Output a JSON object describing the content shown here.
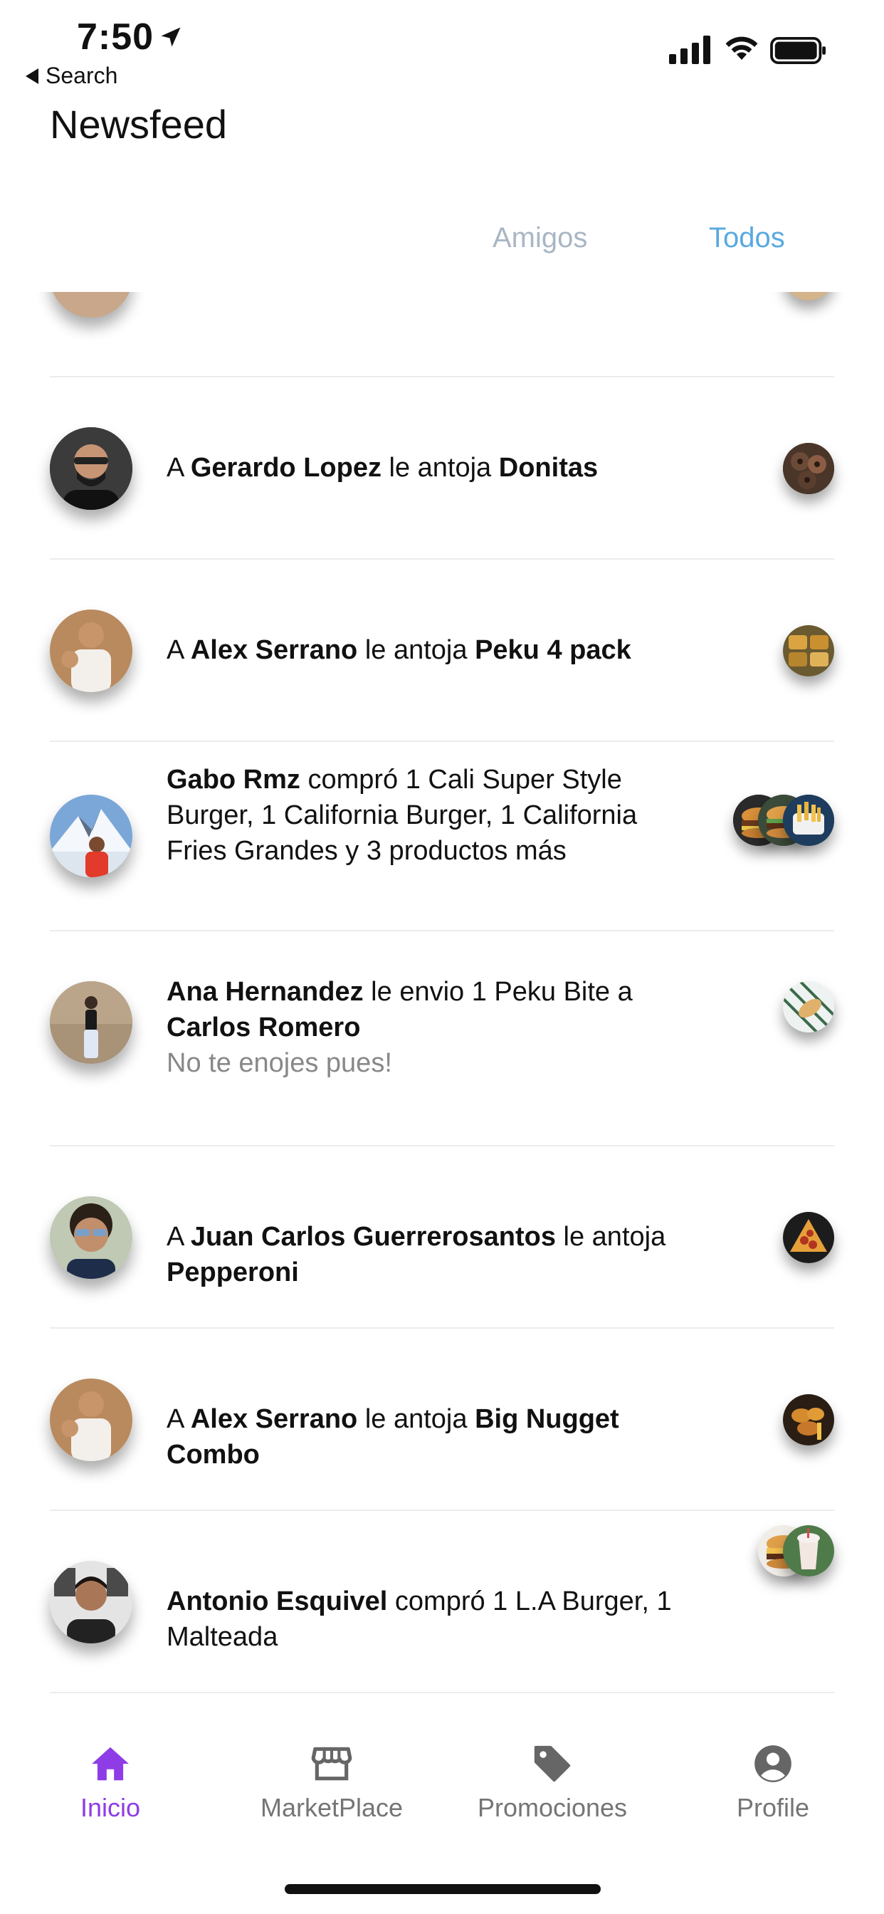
{
  "status_bar": {
    "time": "7:50",
    "back_label": "Search"
  },
  "header": {
    "title": "Newsfeed"
  },
  "tabs": [
    {
      "label": "Amigos",
      "active": false
    },
    {
      "label": "Todos",
      "active": true
    }
  ],
  "feed": [
    {
      "segments": [
        {
          "text": "A ",
          "bold": false
        },
        {
          "text": "Gerardo  Lopez",
          "bold": true
        },
        {
          "text": "  le antoja ",
          "bold": false
        },
        {
          "text": "Donitas",
          "bold": true
        }
      ],
      "thumbs": [
        "donuts"
      ]
    },
    {
      "segments": [
        {
          "text": "A ",
          "bold": false
        },
        {
          "text": "Alex  Serrano",
          "bold": true
        },
        {
          "text": " le antoja ",
          "bold": false
        },
        {
          "text": "Peku 4 pack",
          "bold": true
        }
      ],
      "thumbs": [
        "peku-pack"
      ]
    },
    {
      "segments": [
        {
          "text": "Gabo Rmz",
          "bold": true
        },
        {
          "text": " compró 1 Cali Super Style Burger, 1 California Burger, 1 California Fries Grandes y 3 productos más",
          "bold": false
        }
      ],
      "thumbs": [
        "burger",
        "burger",
        "fries"
      ]
    },
    {
      "segments": [
        {
          "text": "Ana  Hernandez",
          "bold": true
        },
        {
          "text": "  le envio 1 Peku Bite a ",
          "bold": false
        },
        {
          "text": "Carlos Romero",
          "bold": true
        }
      ],
      "subtext": "No te enojes pues!",
      "thumbs": [
        "peku-bite"
      ]
    },
    {
      "segments": [
        {
          "text": "A ",
          "bold": false
        },
        {
          "text": "Juan Carlos Guerrerosantos",
          "bold": true
        },
        {
          "text": " le antoja ",
          "bold": false
        },
        {
          "text": "Pepperoni",
          "bold": true
        }
      ],
      "thumbs": [
        "pepperoni"
      ]
    },
    {
      "segments": [
        {
          "text": "A ",
          "bold": false
        },
        {
          "text": "Alex  Serrano",
          "bold": true
        },
        {
          "text": " le antoja ",
          "bold": false
        },
        {
          "text": "Big Nugget Combo",
          "bold": true
        }
      ],
      "thumbs": [
        "nuggets"
      ]
    },
    {
      "segments": [
        {
          "text": "Antonio Esquivel",
          "bold": true
        },
        {
          "text": " compró 1 L.A Burger, 1 Malteada",
          "bold": false
        }
      ],
      "thumbs": [
        "burger",
        "milkshake"
      ]
    }
  ],
  "bottom_nav": [
    {
      "label": "Inicio",
      "icon": "home-icon",
      "active": true
    },
    {
      "label": "MarketPlace",
      "icon": "store-icon",
      "active": false
    },
    {
      "label": "Promociones",
      "icon": "tag-icon",
      "active": false
    },
    {
      "label": "Profile",
      "icon": "profile-icon",
      "active": false
    }
  ],
  "colors": {
    "accent": "#8e3ce6",
    "tab_active": "#5aa9e0",
    "tab_inactive": "#a9b6c4"
  }
}
